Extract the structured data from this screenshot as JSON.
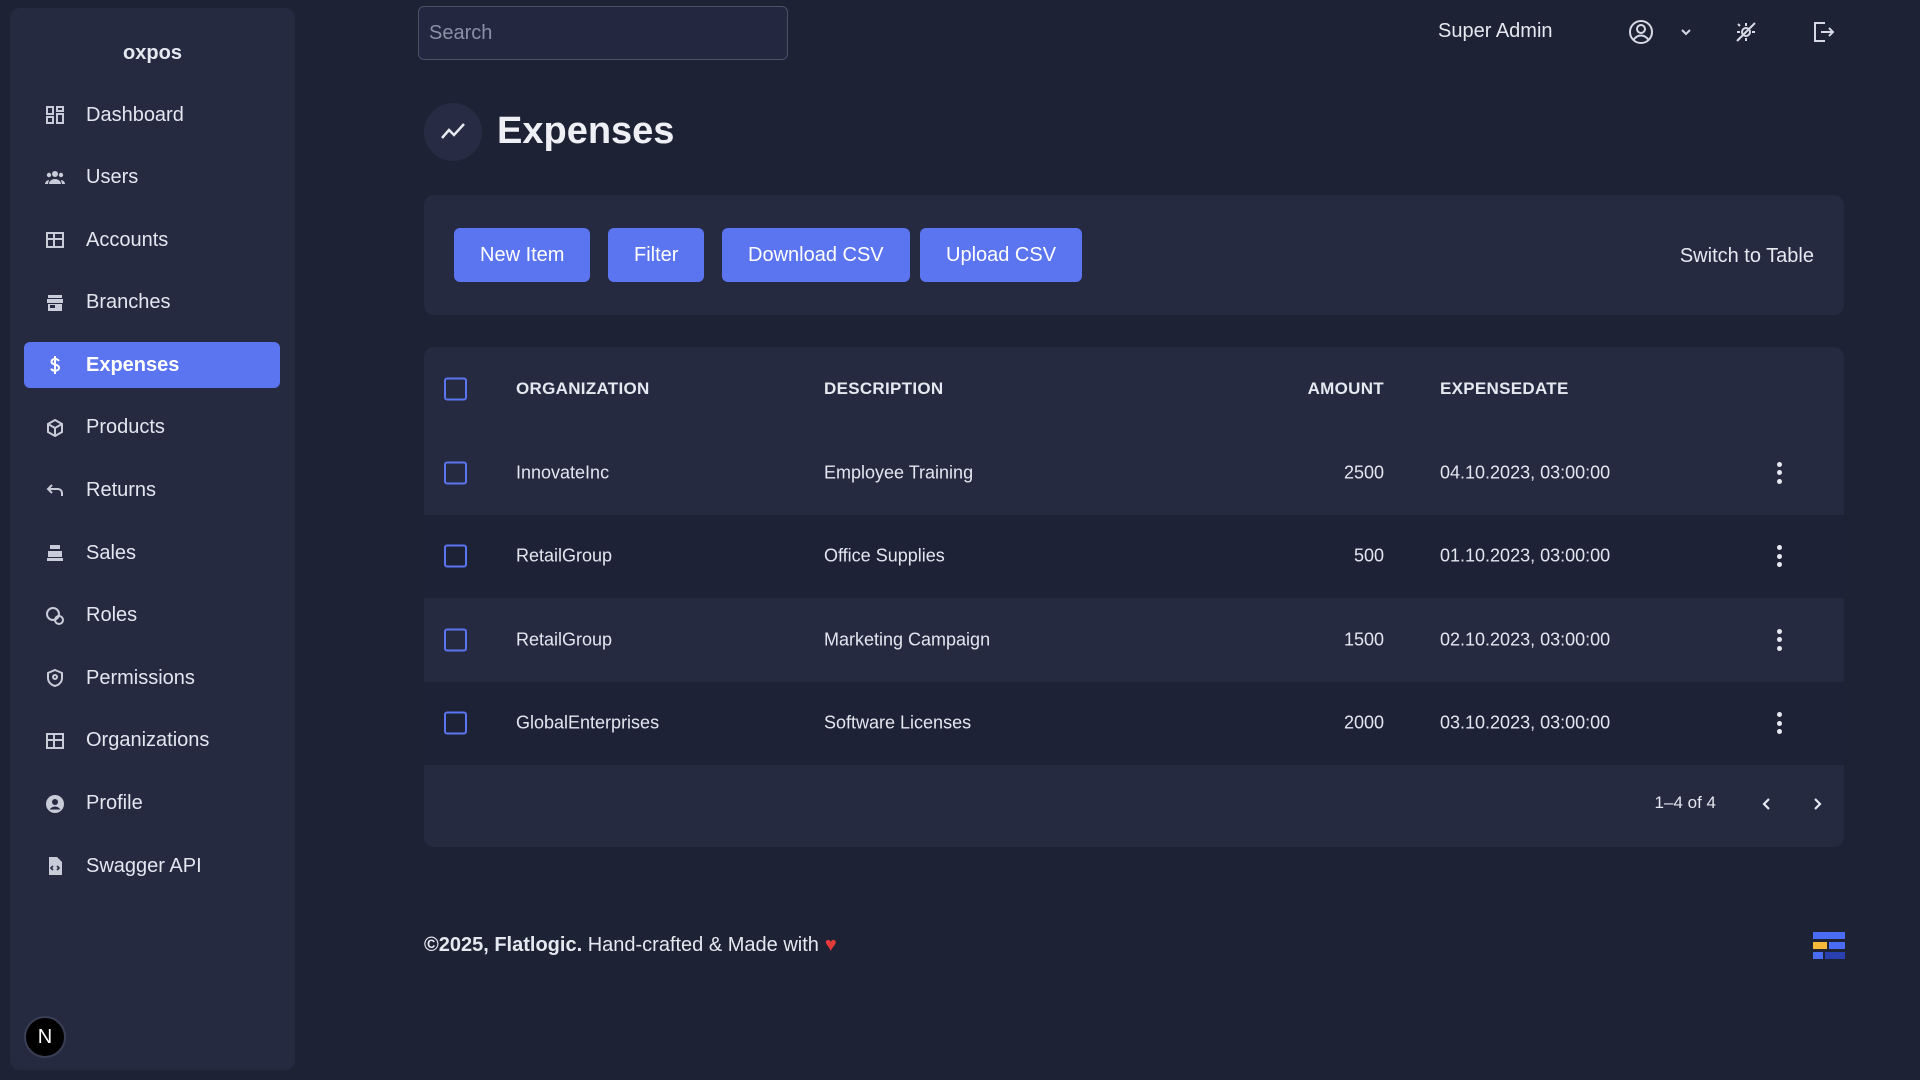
{
  "app": {
    "brand": "oxpos"
  },
  "sidebar": {
    "items": [
      {
        "label": "Dashboard",
        "icon": "dashboard-icon"
      },
      {
        "label": "Users",
        "icon": "users-icon"
      },
      {
        "label": "Accounts",
        "icon": "table-icon"
      },
      {
        "label": "Branches",
        "icon": "store-icon"
      },
      {
        "label": "Expenses",
        "icon": "dollar-icon",
        "active": true
      },
      {
        "label": "Products",
        "icon": "box-icon"
      },
      {
        "label": "Returns",
        "icon": "undo-icon"
      },
      {
        "label": "Sales",
        "icon": "cash-register-icon"
      },
      {
        "label": "Roles",
        "icon": "roles-icon"
      },
      {
        "label": "Permissions",
        "icon": "shield-icon"
      },
      {
        "label": "Organizations",
        "icon": "table-icon"
      },
      {
        "label": "Profile",
        "icon": "account-circle-icon"
      },
      {
        "label": "Swagger API",
        "icon": "file-code-icon"
      }
    ],
    "badge": "N"
  },
  "topbar": {
    "search_placeholder": "Search",
    "user_name": "Super Admin"
  },
  "page": {
    "title": "Expenses"
  },
  "toolbar": {
    "new_item": "New Item",
    "filter": "Filter",
    "download_csv": "Download CSV",
    "upload_csv": "Upload CSV",
    "switch_view": "Switch to Table"
  },
  "table": {
    "columns": [
      "ORGANIZATION",
      "DESCRIPTION",
      "AMOUNT",
      "EXPENSEDATE"
    ],
    "rows": [
      {
        "organization": "InnovateInc",
        "description": "Employee Training",
        "amount": "2500",
        "date": "04.10.2023, 03:00:00"
      },
      {
        "organization": "RetailGroup",
        "description": "Office Supplies",
        "amount": "500",
        "date": "01.10.2023, 03:00:00"
      },
      {
        "organization": "RetailGroup",
        "description": "Marketing Campaign",
        "amount": "1500",
        "date": "02.10.2023, 03:00:00"
      },
      {
        "organization": "GlobalEnterprises",
        "description": "Software Licenses",
        "amount": "2000",
        "date": "03.10.2023, 03:00:00"
      }
    ],
    "pagination": "1–4 of 4"
  },
  "footer": {
    "copyright": "©2025, Flatlogic.",
    "text": "Hand-crafted & Made with",
    "heart": "♥"
  },
  "colors": {
    "background": "#1e2235",
    "panel": "#252a40",
    "accent": "#5b74f0",
    "heart": "#e53a3a"
  }
}
